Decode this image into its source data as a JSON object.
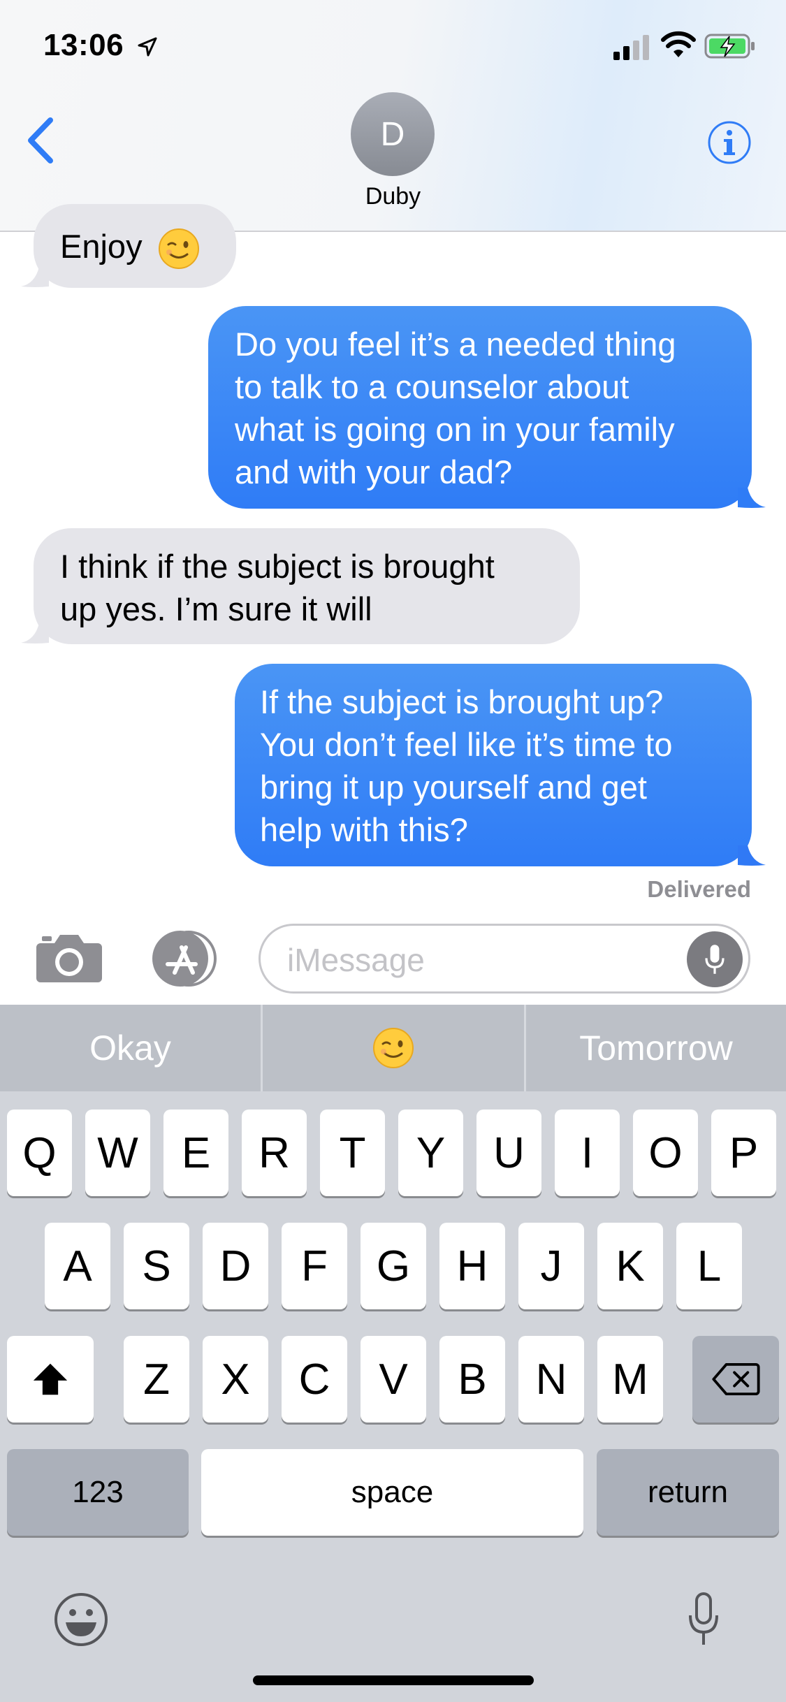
{
  "status_bar": {
    "time": "13:06",
    "icons": [
      "location-arrow-icon",
      "cellular-signal-icon",
      "wifi-icon",
      "battery-charging-icon"
    ]
  },
  "header": {
    "back_icon": "chevron-left-icon",
    "avatar_initial": "D",
    "contact_name": "Duby",
    "info_icon": "info-icon"
  },
  "colors": {
    "accent": "#2f7cf6",
    "incoming_bubble": "#e5e5ea",
    "keyboard_bg": "#d1d4da"
  },
  "messages": [
    {
      "direction": "incoming",
      "lines": [
        "Enjoy"
      ],
      "emoji": "winking-face"
    },
    {
      "direction": "outgoing",
      "lines": [
        "Do you feel it’s a needed thing",
        "to talk to a counselor about",
        "what is going on in your family",
        "and with your dad?"
      ]
    },
    {
      "direction": "incoming",
      "lines": [
        "I think if the subject is brought",
        "up yes. I’m sure it will"
      ]
    },
    {
      "direction": "outgoing",
      "lines": [
        "If the subject is brought up?",
        "You don’t feel like it’s time to",
        "bring it up yourself and get",
        "help with this?"
      ]
    }
  ],
  "delivery_status": "Delivered",
  "input_bar": {
    "camera_icon": "camera-icon",
    "apps_icon": "app-store-icon",
    "placeholder": "iMessage",
    "dictation_icon": "microphone-icon"
  },
  "keyboard": {
    "suggestions": [
      "Okay",
      "winking-face-emoji",
      "Tomorrow"
    ],
    "row1": [
      "Q",
      "W",
      "E",
      "R",
      "T",
      "Y",
      "U",
      "I",
      "O",
      "P"
    ],
    "row2": [
      "A",
      "S",
      "D",
      "F",
      "G",
      "H",
      "J",
      "K",
      "L"
    ],
    "row3": [
      "Z",
      "X",
      "C",
      "V",
      "B",
      "N",
      "M"
    ],
    "shift_icon": "shift-icon",
    "delete_icon": "delete-icon",
    "numbers_label": "123",
    "space_label": "space",
    "return_label": "return",
    "emoji_icon": "emoji-icon",
    "mic_icon": "microphone-icon"
  }
}
